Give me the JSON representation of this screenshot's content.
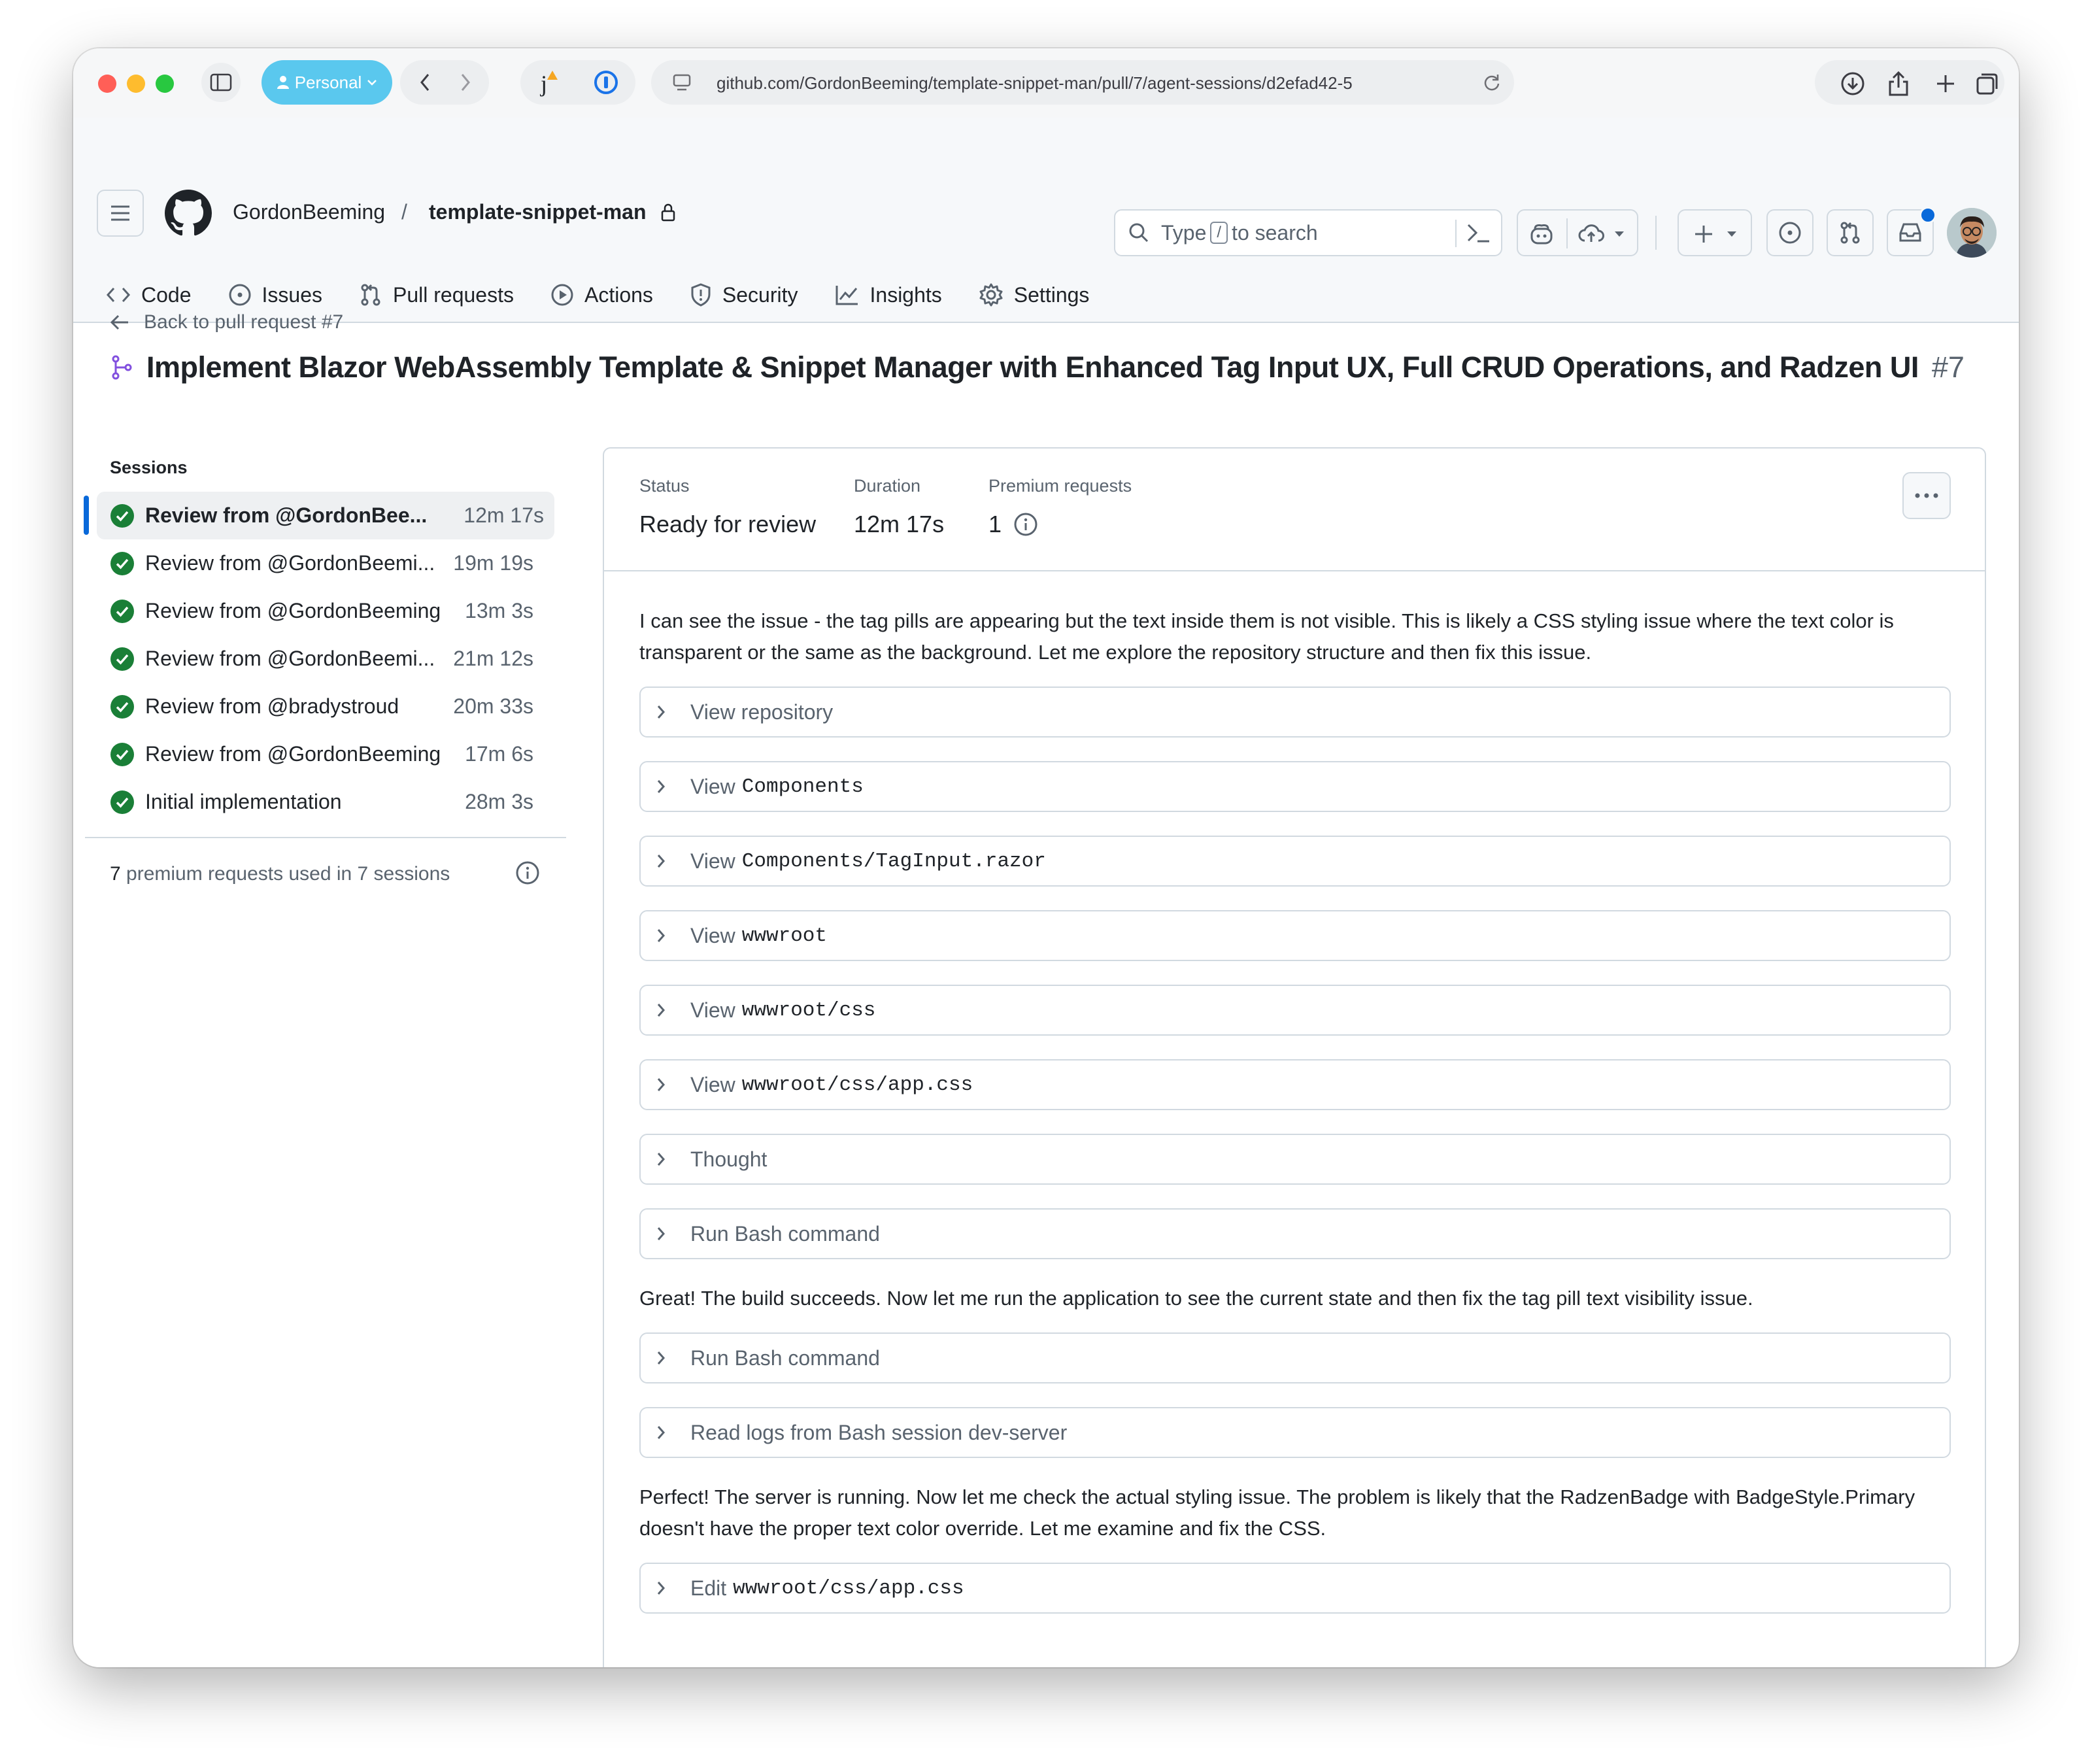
{
  "browser": {
    "profile_label": "Personal",
    "url": "github.com/GordonBeeming/template-snippet-man/pull/7/agent-sessions/d2efad42-5",
    "colors": {
      "close": "#ff5f57",
      "minimize": "#febc2e",
      "zoom": "#28c840",
      "profile": "#5ac8ee"
    }
  },
  "header": {
    "owner": "GordonBeeming",
    "separator": "/",
    "repo": "template-snippet-man",
    "search_prefix": "Type",
    "search_key": "/",
    "search_suffix": "to search"
  },
  "repo_tabs": [
    {
      "label": "Code",
      "icon": "code-icon"
    },
    {
      "label": "Issues",
      "icon": "issue-opened-icon"
    },
    {
      "label": "Pull requests",
      "icon": "git-pull-request-icon"
    },
    {
      "label": "Actions",
      "icon": "play-icon"
    },
    {
      "label": "Security",
      "icon": "shield-icon"
    },
    {
      "label": "Insights",
      "icon": "graph-icon"
    },
    {
      "label": "Settings",
      "icon": "gear-icon"
    }
  ],
  "page": {
    "back_link": "Back to pull request #7",
    "pr_title": "Implement Blazor WebAssembly Template & Snippet Manager with Enhanced Tag Input UX, Full CRUD Operations, and Radzen UI",
    "pr_number": "#7"
  },
  "sessions": {
    "heading": "Sessions",
    "items": [
      {
        "label": "Review from @GordonBee...",
        "duration": "12m 17s",
        "active": true
      },
      {
        "label": "Review from @GordonBeemi...",
        "duration": "19m 19s"
      },
      {
        "label": "Review from @GordonBeeming",
        "duration": "13m 3s"
      },
      {
        "label": "Review from @GordonBeemi...",
        "duration": "21m 12s"
      },
      {
        "label": "Review from @bradystroud",
        "duration": "20m 33s"
      },
      {
        "label": "Review from @GordonBeeming",
        "duration": "17m 6s"
      },
      {
        "label": "Initial implementation",
        "duration": "28m 3s"
      }
    ],
    "premium_count": "7",
    "premium_text": "premium requests used in 7 sessions"
  },
  "session_meta": {
    "status_label": "Status",
    "status_value": "Ready for review",
    "duration_label": "Duration",
    "duration_value": "12m 17s",
    "premium_label": "Premium requests",
    "premium_value": "1"
  },
  "log": {
    "para1": "I can see the issue - the tag pills are appearing but the text inside them is not visible. This is likely a CSS styling issue where the text color is transparent or the same as the background. Let me explore the repository structure and then fix this issue.",
    "steps_a": [
      {
        "action": "View repository",
        "path": ""
      },
      {
        "action": "View",
        "path": "Components"
      },
      {
        "action": "View",
        "path": "Components/TagInput.razor"
      },
      {
        "action": "View",
        "path": "wwwroot"
      },
      {
        "action": "View",
        "path": "wwwroot/css"
      },
      {
        "action": "View",
        "path": "wwwroot/css/app.css"
      },
      {
        "action": "Thought",
        "path": ""
      },
      {
        "action": "Run Bash command",
        "path": ""
      }
    ],
    "para2": "Great! The build succeeds. Now let me run the application to see the current state and then fix the tag pill text visibility issue.",
    "steps_b": [
      {
        "action": "Run Bash command",
        "path": ""
      },
      {
        "action": "Read logs from Bash session dev-server",
        "path": ""
      }
    ],
    "para3": "Perfect! The server is running. Now let me check the actual styling issue. The problem is likely that the RadzenBadge with BadgeStyle.Primary doesn't have the proper text color override. Let me examine and fix the CSS.",
    "steps_c": [
      {
        "action": "Edit",
        "path": "wwwroot/css/app.css"
      }
    ]
  }
}
